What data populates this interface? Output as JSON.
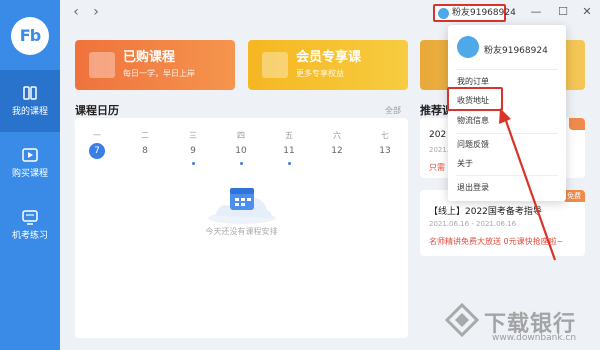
{
  "app": {
    "logo_text": "Fb"
  },
  "sidebar": {
    "items": [
      {
        "label": "我的课程",
        "active": true,
        "icon": "book-icon"
      },
      {
        "label": "购买课程",
        "active": false,
        "icon": "play-icon"
      },
      {
        "label": "机考练习",
        "active": false,
        "icon": "monitor-icon"
      }
    ]
  },
  "titlebar": {
    "back": "‹",
    "forward": "›",
    "username": "粉友91968924",
    "minimize": "—",
    "maximize": "☐",
    "close": "✕"
  },
  "cards": [
    {
      "title": "已购课程",
      "subtitle": "每日一学，早日上岸",
      "icon": "book-icon"
    },
    {
      "title": "会员专享课",
      "subtitle": "更多专享权益",
      "icon": "crown-icon"
    }
  ],
  "calendar": {
    "title": "课程日历",
    "all_link": "全部",
    "weekdays": [
      "一",
      "二",
      "三",
      "四",
      "五",
      "六",
      "七"
    ],
    "days": [
      "7",
      "8",
      "9",
      "10",
      "11",
      "12",
      "13"
    ],
    "today_index": 0,
    "has_dot": [
      false,
      false,
      true,
      true,
      true,
      false,
      false
    ],
    "empty_text": "今天还没有课程安排"
  },
  "recommended": {
    "title": "推荐课",
    "courses": [
      {
        "name": "202",
        "date": "2021.06",
        "note": "只需",
        "badge": ""
      },
      {
        "name": "【线上】2022国考备考指导",
        "date": "2021.06.16 - 2021.06.16",
        "note": "名师精讲免费大放送 0元课快抢座啦~",
        "badge": "免费"
      }
    ]
  },
  "dropdown": {
    "username": "粉友91968924",
    "items": [
      "我的订单",
      "收货地址",
      "物流信息",
      "问题反馈",
      "关于",
      "退出登录"
    ]
  },
  "watermark": {
    "text": "下载银行",
    "url": "www.downbank.cn"
  },
  "colors": {
    "sidebar": "#3a8be8",
    "highlight": "#d9342b",
    "accent": "#3a7ee8"
  }
}
